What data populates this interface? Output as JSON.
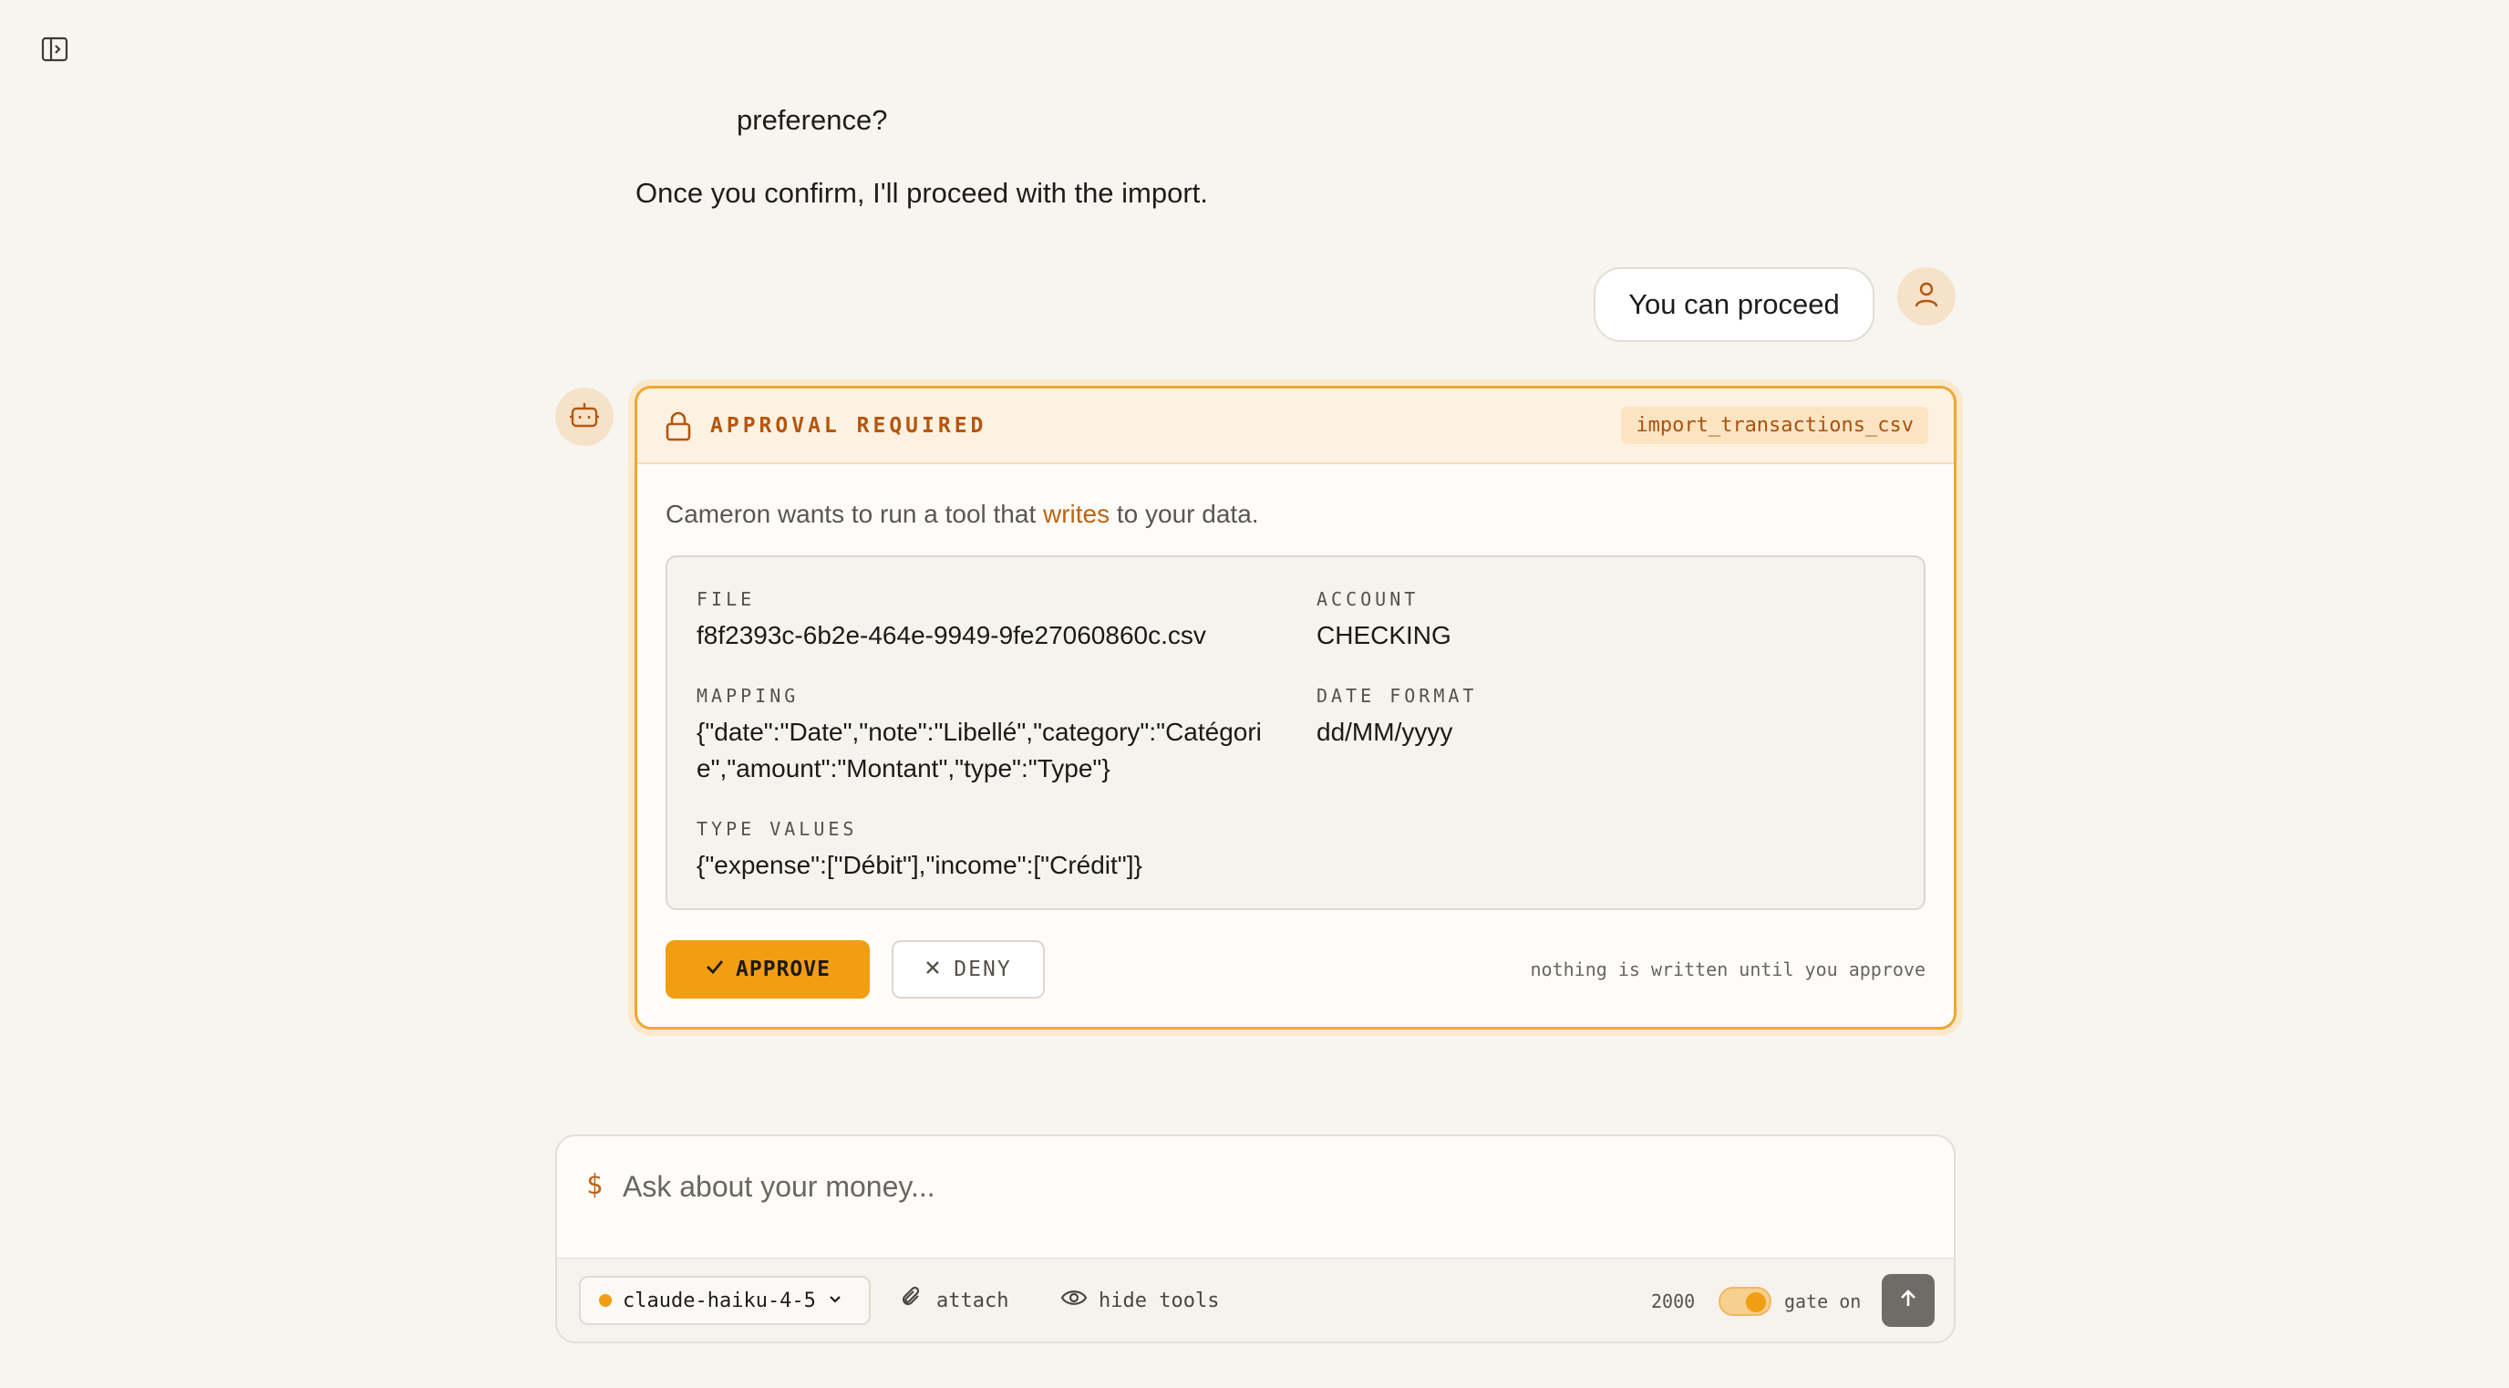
{
  "sidebar": {
    "toggle_icon": "sidebar-panel-icon"
  },
  "conversation": {
    "assistant_line_1": "preference?",
    "assistant_line_2": "Once you confirm, I'll proceed with the import.",
    "user_message": "You can proceed"
  },
  "approval": {
    "title": "APPROVAL REQUIRED",
    "tool_name": "import_transactions_csv",
    "intro_before": "Cameron wants to run a tool that ",
    "intro_highlight": "writes",
    "intro_after": " to your data.",
    "fields": {
      "file_label": "FILE",
      "file_value": "f8f2393c-6b2e-464e-9949-9fe27060860c.csv",
      "account_label": "ACCOUNT",
      "account_value": "CHECKING",
      "mapping_label": "MAPPING",
      "mapping_value": "{\"date\":\"Date\",\"note\":\"Libellé\",\"category\":\"Catégorie\",\"amount\":\"Montant\",\"type\":\"Type\"}",
      "date_format_label": "DATE FORMAT",
      "date_format_value": "dd/MM/yyyy",
      "type_values_label": "TYPE VALUES",
      "type_values_value": "{\"expense\":[\"Débit\"],\"income\":[\"Crédit\"]}"
    },
    "approve_label": "APPROVE",
    "deny_label": "DENY",
    "note": "nothing is written until you approve"
  },
  "composer": {
    "prefix": "$",
    "placeholder": "Ask about your money...",
    "model": "claude-haiku-4-5",
    "attach_label": "attach",
    "hide_tools_label": "hide tools",
    "token_count": "2000",
    "gate_label": "gate on",
    "gate_enabled": true
  },
  "colors": {
    "accent": "#f29e12",
    "accent_text": "#b5560f",
    "background": "#f7f5f0"
  }
}
